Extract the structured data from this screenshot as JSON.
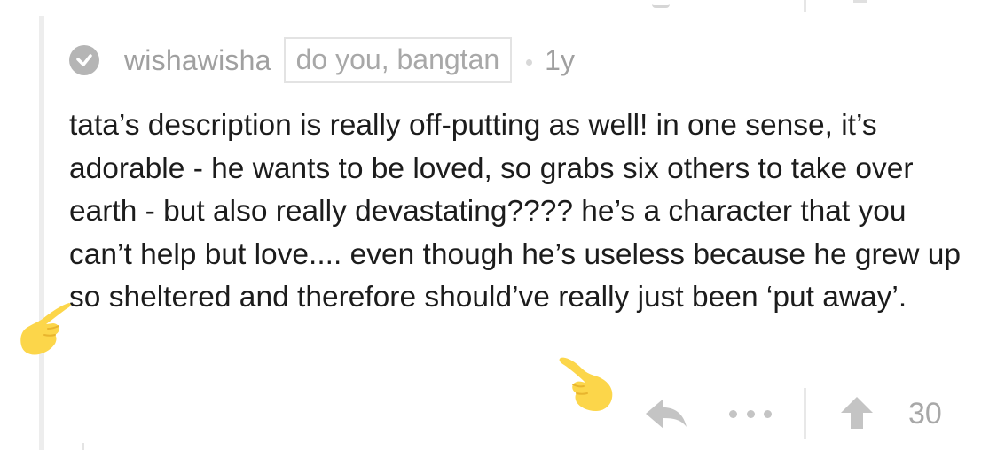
{
  "comment": {
    "username": "wishawisha",
    "flair": "do you, bangtan",
    "separator": "·",
    "timestamp": "1y",
    "avatar_icon": "check-circle-icon",
    "body": "tata’s description is really off-putting as well! in one sense, it’s adorable - he wants to be loved, so grabs six others to take over earth - but also really devastating???? he’s a character that you can’t help but love.... even though he’s useless because he grew up so sheltered and therefore should’ve really just been ‘put away’.",
    "score": "30"
  },
  "actions": {
    "reply_icon": "reply-arrow-icon",
    "more_icon": "more-options-icon",
    "upvote_icon": "upvote-arrow-icon"
  },
  "annotations": {
    "left_emoji": "pointing-hand-emoji",
    "right_emoji": "pointing-hand-emoji"
  },
  "colors": {
    "meta_gray": "#a0a0a0",
    "body_text": "#1c1c1c",
    "icon_gray": "#c4c4c4",
    "emoji_yellow": "#fcd64a"
  }
}
